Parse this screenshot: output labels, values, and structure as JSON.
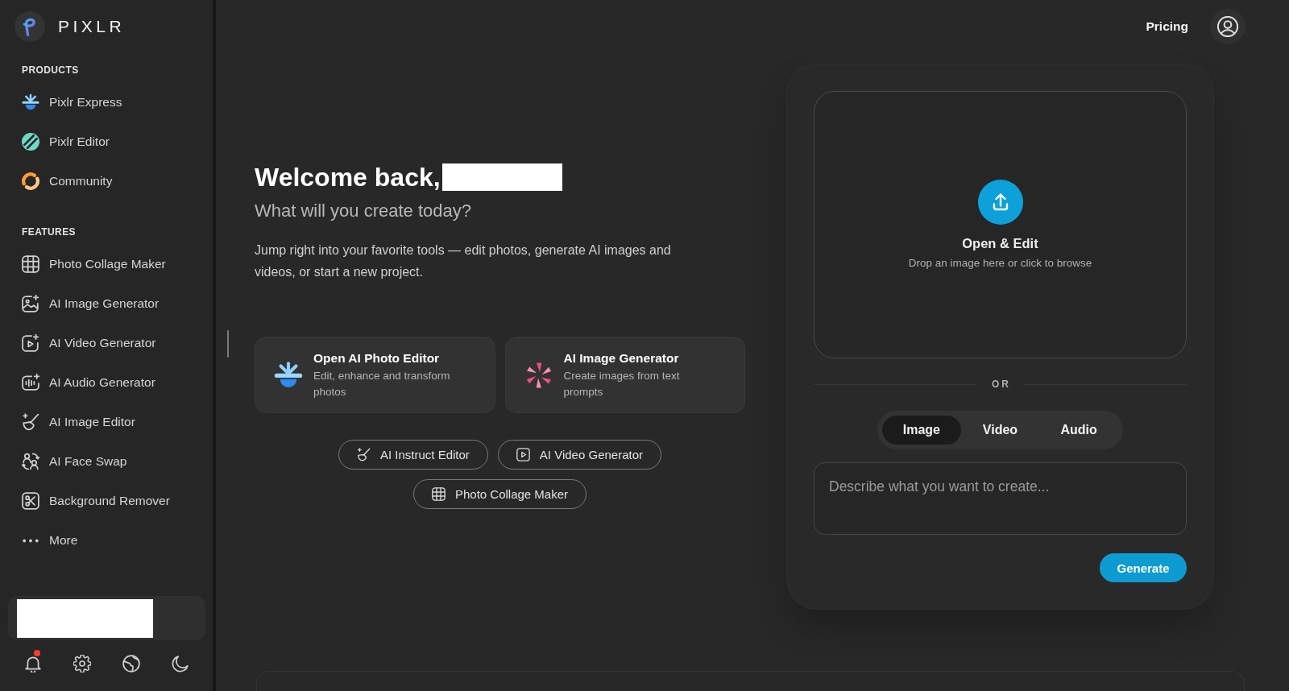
{
  "sidebar": {
    "brand": "PIXLR",
    "sections": [
      {
        "heading": "PRODUCTS",
        "items": [
          {
            "label": "Pixlr Express"
          },
          {
            "label": "Pixlr Editor"
          },
          {
            "label": "Community"
          }
        ]
      },
      {
        "heading": "FEATURES",
        "items": [
          {
            "label": "Photo Collage Maker"
          },
          {
            "label": "AI Image Generator"
          },
          {
            "label": "AI Video Generator"
          },
          {
            "label": "AI Audio Generator"
          },
          {
            "label": "AI Image Editor"
          },
          {
            "label": "AI Face Swap"
          },
          {
            "label": "Background Remover"
          },
          {
            "label": "More"
          }
        ]
      }
    ],
    "account_card": {
      "name_hidden": true
    },
    "footer": {
      "notifications_unread": true
    }
  },
  "header": {
    "link": "Pricing"
  },
  "welcome": {
    "greeting": "Welcome back,",
    "name_hidden": true,
    "subtitle": "What will you create today?",
    "intro": "Jump right into your favorite tools — edit photos, generate AI images and videos, or start a new project."
  },
  "tool_cards": [
    {
      "title": "Open AI Photo Editor",
      "description": "Edit, enhance and transform photos"
    },
    {
      "title": "AI Image Generator",
      "description": "Create images from text prompts"
    }
  ],
  "quick_links": [
    {
      "label": "AI Instruct Editor"
    },
    {
      "label": "AI Video Generator"
    },
    {
      "label": "Photo Collage Maker"
    }
  ],
  "create_panel": {
    "upload": {
      "title": "Open & Edit",
      "hint": "Drop an image here or click to browse"
    },
    "divider": "OR",
    "mode_tabs": [
      {
        "label": "Image",
        "selected": true
      },
      {
        "label": "Video",
        "selected": false
      },
      {
        "label": "Audio",
        "selected": false
      }
    ],
    "prompt": {
      "placeholder": "Describe what you want to create..."
    },
    "action": "Generate"
  }
}
